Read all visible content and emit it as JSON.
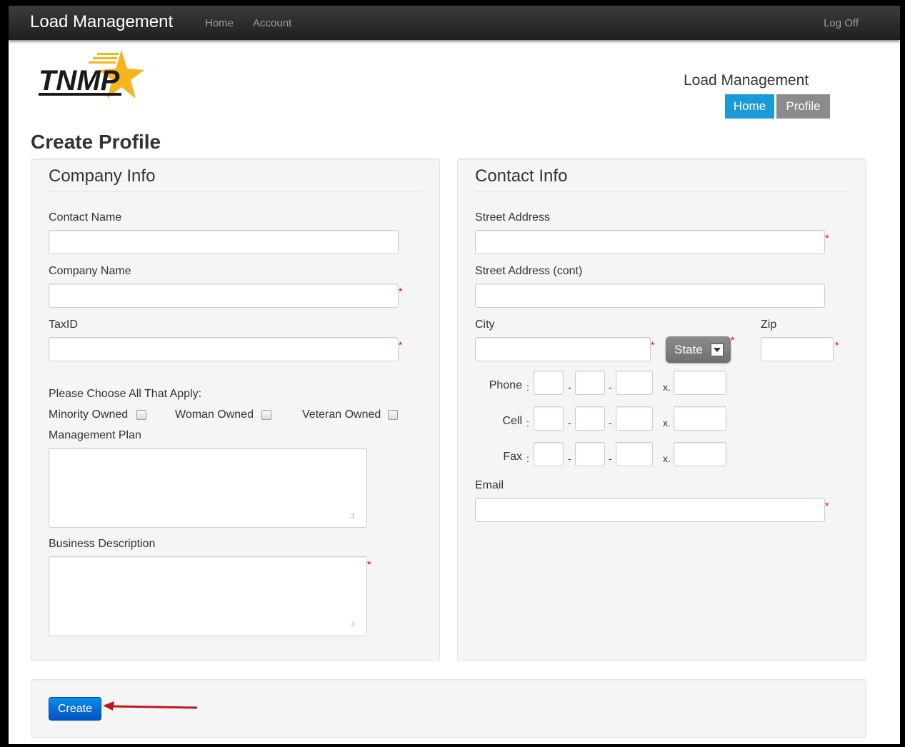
{
  "navbar": {
    "brand": "Load Management",
    "links": [
      "Home",
      "Account"
    ],
    "logoff": "Log Off"
  },
  "logo_text": "TNMP",
  "header": {
    "title": "Load Management",
    "home_button": "Home",
    "profile_button": "Profile"
  },
  "page_title": "Create Profile",
  "company": {
    "title": "Company Info",
    "contact_name_label": "Contact Name",
    "company_name_label": "Company Name",
    "taxid_label": "TaxID",
    "choose_label": "Please Choose All That Apply:",
    "minority_label": "Minority Owned",
    "woman_label": "Woman Owned",
    "veteran_label": "Veteran Owned",
    "plan_label": "Management Plan",
    "desc_label": "Business Description"
  },
  "contact": {
    "title": "Contact Info",
    "street_label": "Street Address",
    "street2_label": "Street Address (cont)",
    "city_label": "City",
    "state_select": "State",
    "zip_label": "Zip",
    "phone_label": "Phone",
    "cell_label": "Cell",
    "fax_label": "Fax",
    "colon": ":",
    "dash": "-",
    "ext": "x.",
    "email_label": "Email"
  },
  "required_mark": "*",
  "grip": ".:i",
  "create_button": "Create",
  "colors": {
    "accent": "#1a9ad6",
    "secondary": "#8b8b8b",
    "primary_button": "#0a6fd9",
    "required": "#e00000",
    "arrow": "#c0161b",
    "logo_gold": "#f5b51c"
  }
}
